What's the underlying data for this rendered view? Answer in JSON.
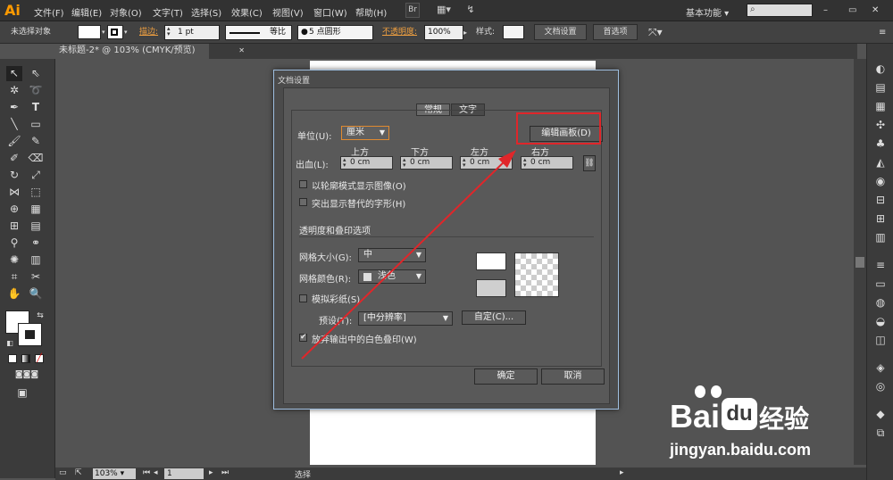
{
  "app": {
    "logo": "Ai"
  },
  "menubar": {
    "items": [
      "文件(F)",
      "编辑(E)",
      "对象(O)",
      "文字(T)",
      "选择(S)",
      "效果(C)",
      "视图(V)",
      "窗口(W)",
      "帮助(H)"
    ],
    "bridge": "Br",
    "workspace": "基本功能",
    "window_controls": [
      "–",
      "▭",
      "✕"
    ]
  },
  "control_bar": {
    "selection_label": "未选择对象",
    "stroke_label": "描边:",
    "stroke_value": "1 pt",
    "stroke_profile": "等比",
    "brush": "5 点圆形",
    "opacity_label": "不透明度:",
    "opacity_value": "100%",
    "style_label": "样式:",
    "doc_setup_btn": "文档设置",
    "prefs_btn": "首选项"
  },
  "document_tab": {
    "title": "未标题-2* @ 103% (CMYK/预览)",
    "close": "✕"
  },
  "statusbar": {
    "zoom": "103%",
    "page": "1",
    "tool": "选择"
  },
  "dialog": {
    "title": "文档设置",
    "tabs": [
      "常规",
      "文字"
    ],
    "unit_label": "单位(U):",
    "unit_value": "厘米",
    "edit_artboard_btn": "编辑画板(D)",
    "bleed_label": "出血(L):",
    "bleed_headers": [
      "上方",
      "下方",
      "左方",
      "右方"
    ],
    "bleed_values": [
      "0 cm",
      "0 cm",
      "0 cm",
      "0 cm"
    ],
    "opt_outline": "以轮廓模式显示图像(O)",
    "opt_highlight": "突出显示替代的字形(H)",
    "section_transparency": "透明度和叠印选项",
    "grid_size_label": "网格大小(G):",
    "grid_size_value": "中",
    "grid_color_label": "网格颜色(R):",
    "grid_color_value": "浅色",
    "simulate_paper": "模拟彩纸(S)",
    "preset_label": "预设(T):",
    "preset_value": "[中分辨率]",
    "custom_btn": "自定(C)...",
    "discard_white": "放弃输出中的白色叠印(W)",
    "discard_white_checked": true,
    "ok_btn": "确定",
    "cancel_btn": "取消"
  },
  "watermark": {
    "brand": "Bai",
    "brand2": "du",
    "cn": "经验",
    "url": "jingyan.baidu.com"
  },
  "colors": {
    "highlight": "#e0262a",
    "accent": "#ff9a00"
  }
}
